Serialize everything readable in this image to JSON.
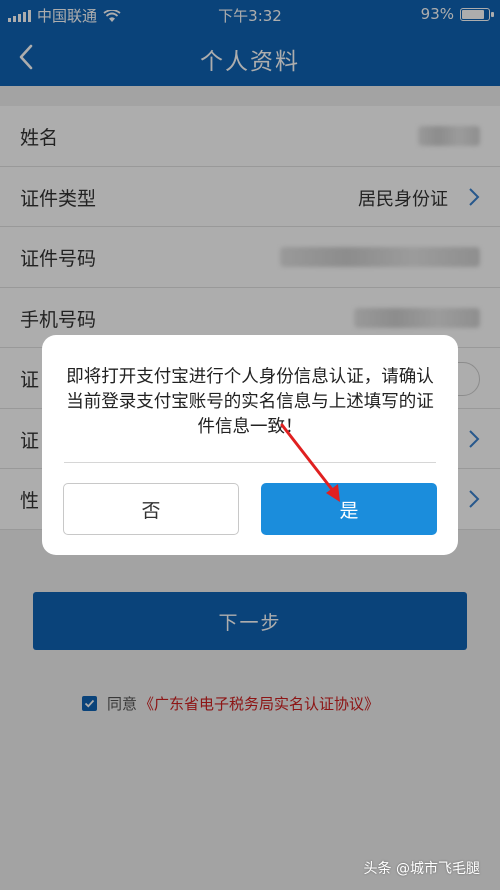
{
  "status_bar": {
    "carrier": "中国联通",
    "time": "下午3:32",
    "battery": "93%",
    "battery_level": 0.93
  },
  "header": {
    "title": "个人资料",
    "back_icon": "chevron-left-icon"
  },
  "form": {
    "rows": [
      {
        "label": "姓名",
        "value": ""
      },
      {
        "label": "证件类型",
        "value": "居民身份证"
      },
      {
        "label": "证件号码",
        "value": ""
      },
      {
        "label": "手机号码",
        "value": ""
      },
      {
        "label": "证",
        "value": ""
      },
      {
        "label": "证",
        "value": ""
      },
      {
        "label": "性",
        "value": ""
      }
    ]
  },
  "next_button": {
    "label": "下一步"
  },
  "agreement": {
    "prefix": "同意",
    "link": "《广东省电子税务局实名认证协议》",
    "checked": true
  },
  "dialog": {
    "message": "即将打开支付宝进行个人身份信息认证，请确认当前登录支付宝账号的实名信息与上述填写的证件信息一致！",
    "cancel_label": "否",
    "confirm_label": "是"
  },
  "colors": {
    "brand": "#1064b4",
    "confirm": "#1b8ddc",
    "link": "#d02020",
    "annotation_arrow": "#e02020"
  },
  "watermark": "头条 @城市飞毛腿"
}
